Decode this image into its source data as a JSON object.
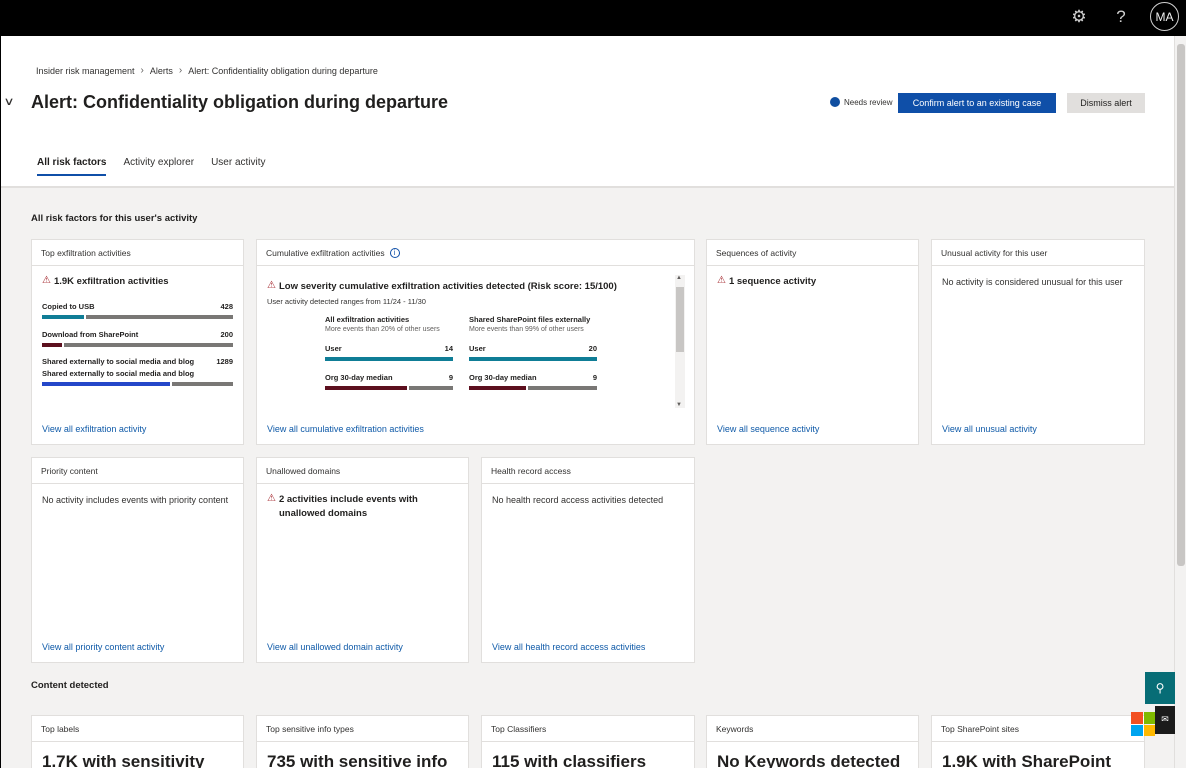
{
  "topbar": {
    "settings_icon": "gear-icon",
    "help_icon": "question-icon",
    "avatar_initials": "MA"
  },
  "breadcrumb": [
    "Insider risk management",
    "Alerts",
    "Alert: Confidentiality obligation during departure"
  ],
  "header": {
    "title": "Alert: Confidentiality obligation during departure",
    "status": "Needs review",
    "status_color": "#0f4ea0",
    "confirm_button": "Confirm alert to an existing case",
    "dismiss_button": "Dismiss alert",
    "accent_color": "#0f4fa8"
  },
  "tabs": [
    {
      "label": "All risk factors",
      "active": true
    },
    {
      "label": "Activity explorer",
      "active": false
    },
    {
      "label": "User activity",
      "active": false
    }
  ],
  "risk_section_title": "All risk factors for this user's activity",
  "cards": {
    "top_exfiltration": {
      "title": "Top exfiltration activities",
      "headline": "1.9K exfiltration activities",
      "rows": [
        {
          "label": "Copied to USB",
          "value": "428"
        },
        {
          "label": "Download from SharePoint",
          "value": "200"
        },
        {
          "label": "Shared externally to social media and blog",
          "value": "1289"
        },
        {
          "label": "Shared externally to social media and blog",
          "value": ""
        }
      ],
      "link": "View all exfiltration activity"
    },
    "cumulative": {
      "title": "Cumulative exfiltration activities",
      "headline": "Low severity cumulative exfiltration activities detected (Risk score: 15/100)",
      "subtext": "User activity detected ranges from 11/24 - 11/30",
      "col1": {
        "title": "All exfiltration activities",
        "sub": "More events than 20% of other users",
        "user_label": "User",
        "user_value": "14",
        "median_label": "Org 30-day median",
        "median_value": "9"
      },
      "col2": {
        "title": "Shared SharePoint files externally",
        "sub": "More events than 99% of other users",
        "user_label": "User",
        "user_value": "20",
        "median_label": "Org 30-day median",
        "median_value": "9"
      },
      "link": "View all cumulative exfiltration activities"
    },
    "sequences": {
      "title": "Sequences of activity",
      "headline": "1 sequence activity",
      "link": "View all sequence activity"
    },
    "unusual": {
      "title": "Unusual activity for this user",
      "text": "No activity is considered unusual for this user",
      "link": "View all unusual activity"
    },
    "priority": {
      "title": "Priority content",
      "text": "No activity includes events with priority content",
      "link": "View all priority content activity"
    },
    "unallowed": {
      "title": "Unallowed domains",
      "headline": "2 activities include events with unallowed domains",
      "link": "View all unallowed domain activity"
    },
    "health": {
      "title": "Health record access",
      "text": "No health record access activities detected",
      "link": "View all health record access activities"
    }
  },
  "content_section_title": "Content detected",
  "content_cards": [
    {
      "title": "Top labels",
      "value": "1.7K with sensitivity"
    },
    {
      "title": "Top sensitive info types",
      "value": "735 with sensitive info"
    },
    {
      "title": "Top Classifiers",
      "value": "115 with classifiers"
    },
    {
      "title": "Keywords",
      "value": "No Keywords detected"
    },
    {
      "title": "Top SharePoint sites",
      "value": "1.9K with SharePoint"
    }
  ],
  "colors": {
    "teal": "#0f7d96",
    "maroon": "#5c0f1e",
    "blue": "#2447c9",
    "grey": "#797775"
  }
}
